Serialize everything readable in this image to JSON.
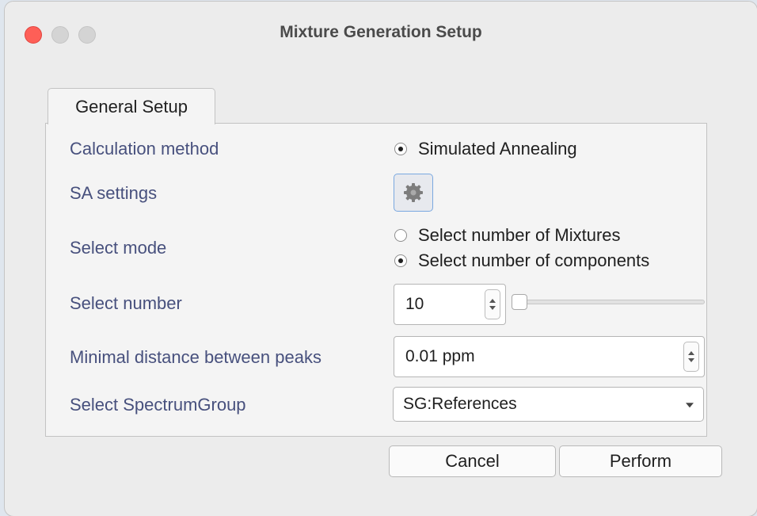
{
  "window": {
    "title": "Mixture Generation Setup"
  },
  "tabs": [
    {
      "label": "General Setup",
      "selected": true
    }
  ],
  "form": {
    "calculation_method": {
      "label": "Calculation method",
      "option": "Simulated Annealing",
      "checked": true
    },
    "sa_settings": {
      "label": "SA settings",
      "icon": "gear-icon"
    },
    "select_mode": {
      "label": "Select mode",
      "options": [
        {
          "label": "Select number of Mixtures",
          "checked": false
        },
        {
          "label": "Select number of components",
          "checked": true
        }
      ]
    },
    "select_number": {
      "label": "Select number",
      "value": "10",
      "slider_fraction": 0.0
    },
    "min_distance": {
      "label": "Minimal distance between peaks",
      "value": "0.01 ppm"
    },
    "spectrum_group": {
      "label": "Select SpectrumGroup",
      "value": "SG:References"
    }
  },
  "buttons": {
    "cancel": "Cancel",
    "perform": "Perform"
  },
  "colors": {
    "label_text": "#47507d",
    "close_button": "#fe5f57",
    "window_bg": "#ececec",
    "panel_bg": "#f4f4f4"
  }
}
